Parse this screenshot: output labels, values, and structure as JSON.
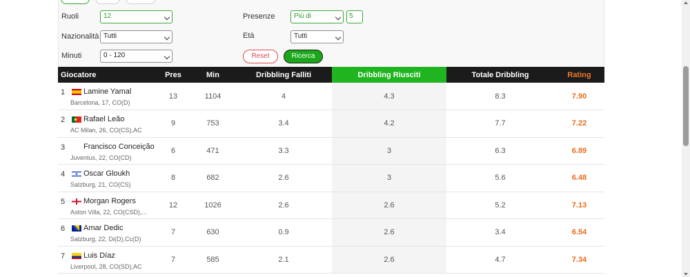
{
  "filters": {
    "ruoli": {
      "label": "Ruoli",
      "value": "12"
    },
    "nazionalita": {
      "label": "Nazionalità",
      "value": "Tutti"
    },
    "minuti": {
      "label": "Minuti",
      "value": "0 - 120"
    },
    "presenze": {
      "label": "Presenze",
      "value": "Più di",
      "count": "5"
    },
    "eta": {
      "label": "Età",
      "value": "Tutti"
    },
    "reset_label": "Reset",
    "search_label": "Ricerca"
  },
  "table": {
    "headers": {
      "player": "Giocatore",
      "pres": "Pres",
      "min": "Min",
      "failed": "Dribbling Falliti",
      "success": "Dribbling Riusciti",
      "total": "Totale Dribbling",
      "rating": "Rating"
    },
    "rows": [
      {
        "pos": "1",
        "flag": "spain-flag",
        "name": "Lamine Yamal",
        "meta": "Barcelona,  17, CO(D)",
        "pres": "13",
        "min": "1104",
        "failed": "4",
        "success": "4.3",
        "total": "8.3",
        "rating": "7.90"
      },
      {
        "pos": "2",
        "flag": "portugal-flag",
        "name": "Rafael Leão",
        "meta": "AC Milan,  26, CO(CS),AC",
        "pres": "9",
        "min": "753",
        "failed": "3.4",
        "success": "4.2",
        "total": "7.7",
        "rating": "7.22"
      },
      {
        "pos": "3",
        "flag": "",
        "name": "Francisco Conceição",
        "meta": "Juventus,  22, CO(CD)",
        "pres": "6",
        "min": "471",
        "failed": "3.3",
        "success": "3",
        "total": "6.3",
        "rating": "6.89"
      },
      {
        "pos": "4",
        "flag": "israel-flag",
        "name": "Oscar Gloukh",
        "meta": "Salzburg,  21, CO(CS)",
        "pres": "8",
        "min": "682",
        "failed": "2.6",
        "success": "3",
        "total": "5.6",
        "rating": "6.48"
      },
      {
        "pos": "5",
        "flag": "england-flag",
        "name": "Morgan Rogers",
        "meta": "Aston Villa,  22, CO(CSD),...",
        "pres": "12",
        "min": "1026",
        "failed": "2.6",
        "success": "2.6",
        "total": "5.2",
        "rating": "7.13"
      },
      {
        "pos": "6",
        "flag": "bosnia-flag",
        "name": "Amar Dedic",
        "meta": "Salzburg,  22, Di(D),Cc(D)",
        "pres": "7",
        "min": "630",
        "failed": "0.9",
        "success": "2.6",
        "total": "3.4",
        "rating": "6.54"
      },
      {
        "pos": "7",
        "flag": "colombia-flag",
        "name": "Luis Díaz",
        "meta": "Liverpool,  28, CO(SD),AC",
        "pres": "7",
        "min": "585",
        "failed": "2.1",
        "success": "2.6",
        "total": "4.7",
        "rating": "7.34"
      }
    ]
  },
  "colors": {
    "accent_green": "#20b520",
    "rating_orange": "#e96b18",
    "reset_red": "#d94b4b",
    "header_dark": "#1b1b1b"
  }
}
